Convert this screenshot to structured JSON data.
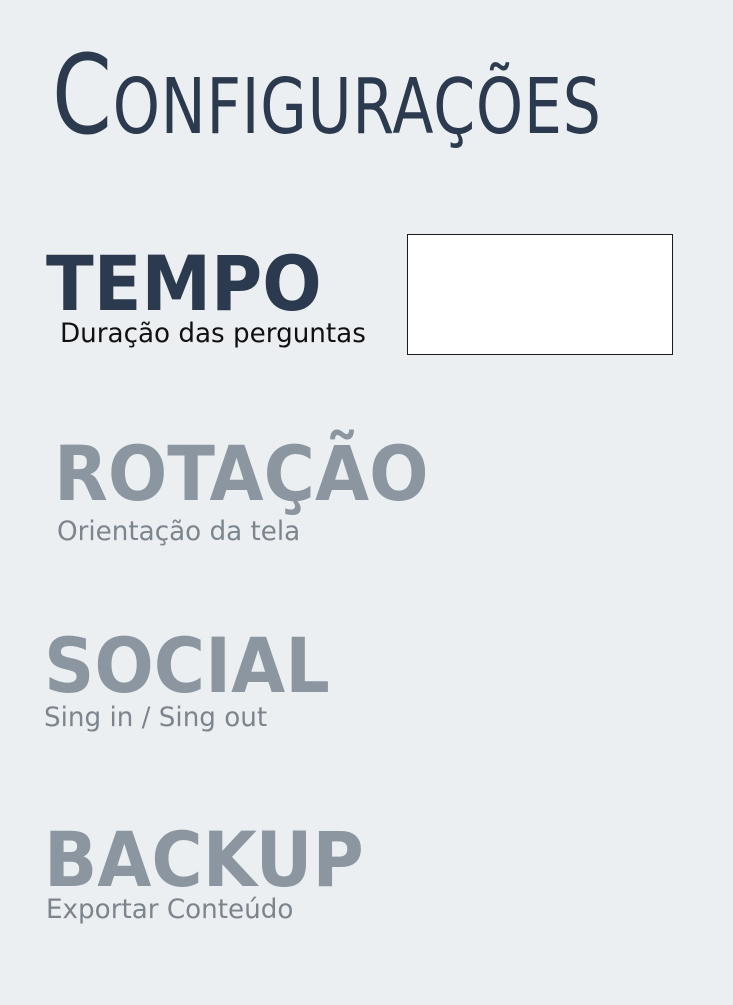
{
  "page": {
    "title": "Configurações"
  },
  "settings": [
    {
      "key": "tempo",
      "heading": "TEMPO",
      "subtitle": "Duração das perguntas",
      "state": "active",
      "input": {
        "value": "",
        "placeholder": ""
      }
    },
    {
      "key": "rotacao",
      "heading": "ROTAÇÃO",
      "subtitle": "Orientação da tela",
      "state": "disabled"
    },
    {
      "key": "social",
      "heading": "SOCIAL",
      "subtitle": "Sing in / Sing out",
      "state": "disabled"
    },
    {
      "key": "backup",
      "heading": "BACKUP",
      "subtitle": "Exportar Conteúdo",
      "state": "disabled"
    }
  ],
  "colors": {
    "background": "#eceff1",
    "active_heading": "#2b3a4e",
    "disabled_heading": "#8c96a0",
    "input_background": "#ffffff"
  }
}
